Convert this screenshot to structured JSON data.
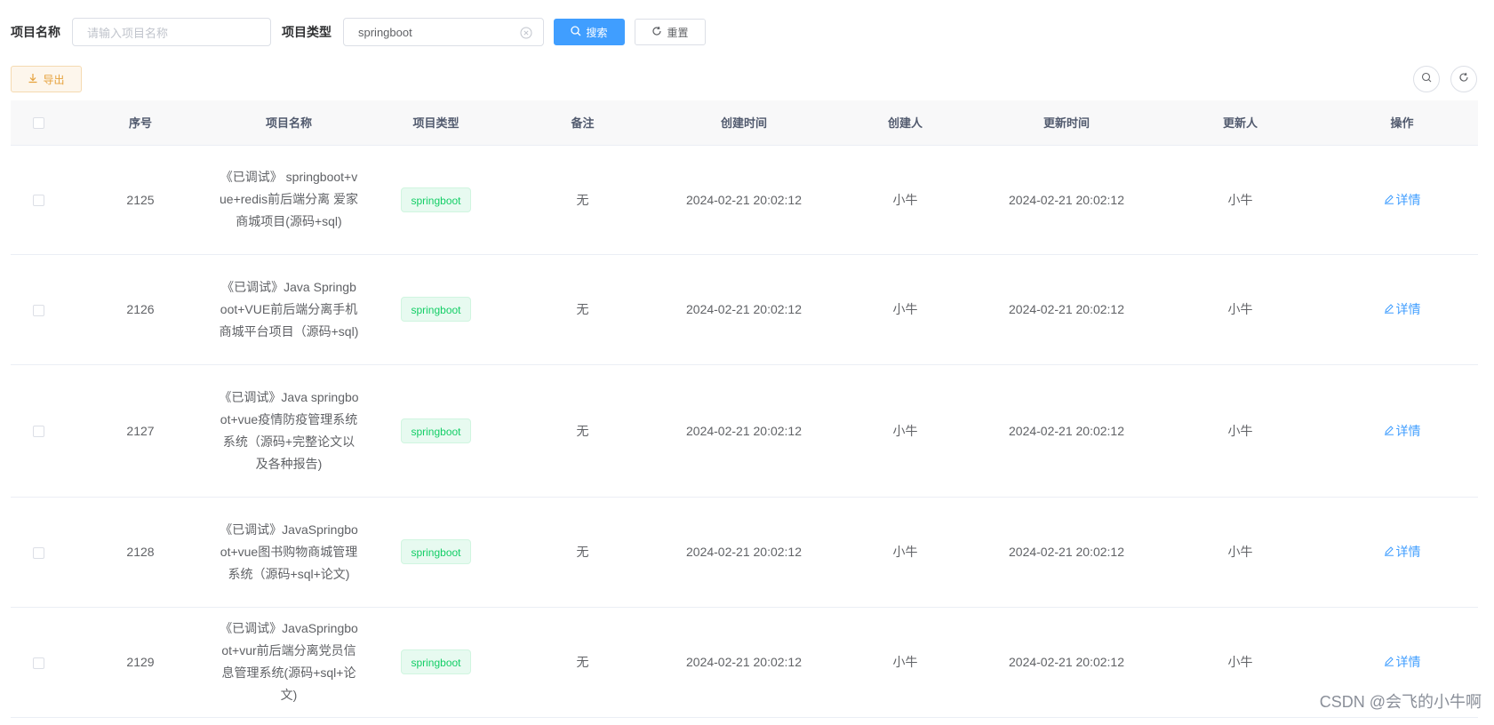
{
  "search": {
    "name_label": "项目名称",
    "name_placeholder": "请输入项目名称",
    "type_label": "项目类型",
    "type_value": "springboot",
    "search_button": "搜索",
    "reset_button": "重置"
  },
  "toolbar": {
    "export_button": "导出"
  },
  "table": {
    "headers": {
      "index": "序号",
      "name": "项目名称",
      "type": "项目类型",
      "remark": "备注",
      "created_at": "创建时间",
      "creator": "创建人",
      "updated_at": "更新时间",
      "updater": "更新人",
      "actions": "操作"
    },
    "rows": [
      {
        "index": "2125",
        "name": "《已调试》 springboot+vue+redis前后端分离 爱家商城项目(源码+sql)",
        "type": "springboot",
        "remark": "无",
        "created_at": "2024-02-21 20:02:12",
        "creator": "小牛",
        "updated_at": "2024-02-21 20:02:12",
        "updater": "小牛",
        "action": "详情"
      },
      {
        "index": "2126",
        "name": "《已调试》Java Springboot+VUE前后端分离手机商城平台项目（源码+sql)",
        "type": "springboot",
        "remark": "无",
        "created_at": "2024-02-21 20:02:12",
        "creator": "小牛",
        "updated_at": "2024-02-21 20:02:12",
        "updater": "小牛",
        "action": "详情"
      },
      {
        "index": "2127",
        "name": "《已调试》Java springboot+vue疫情防疫管理系统系统（源码+完整论文以及各种报告)",
        "type": "springboot",
        "remark": "无",
        "created_at": "2024-02-21 20:02:12",
        "creator": "小牛",
        "updated_at": "2024-02-21 20:02:12",
        "updater": "小牛",
        "action": "详情"
      },
      {
        "index": "2128",
        "name": "《已调试》JavaSpringboot+vue图书购物商城管理系统（源码+sql+论文)",
        "type": "springboot",
        "remark": "无",
        "created_at": "2024-02-21 20:02:12",
        "creator": "小牛",
        "updated_at": "2024-02-21 20:02:12",
        "updater": "小牛",
        "action": "详情"
      },
      {
        "index": "2129",
        "name": "《已调试》JavaSpringboot+vur前后端分离党员信息管理系统(源码+sql+论文)",
        "type": "springboot",
        "remark": "无",
        "created_at": "2024-02-21 20:02:12",
        "creator": "小牛",
        "updated_at": "2024-02-21 20:02:12",
        "updater": "小牛",
        "action": "详情"
      }
    ]
  },
  "watermark": "CSDN @会飞的小牛啊",
  "colors": {
    "primary": "#409eff",
    "success": "#13ce66",
    "warning": "#e6a23c"
  }
}
